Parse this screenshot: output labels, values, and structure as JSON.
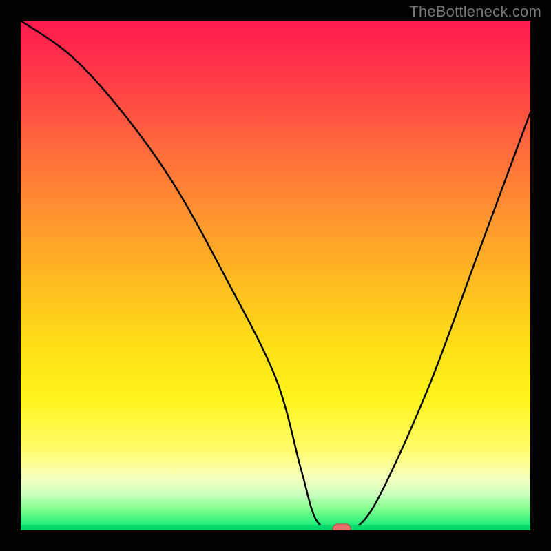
{
  "watermark": "TheBottleneck.com",
  "chart_data": {
    "type": "line",
    "title": "",
    "xlabel": "",
    "ylabel": "",
    "xlim": [
      0,
      100
    ],
    "ylim": [
      0,
      100
    ],
    "x": [
      0,
      10,
      20,
      30,
      40,
      50,
      55,
      58,
      62,
      65,
      70,
      80,
      90,
      100
    ],
    "values": [
      100,
      93,
      82,
      68,
      50,
      30,
      12,
      2,
      0,
      0,
      6,
      28,
      55,
      82
    ],
    "series": [
      {
        "name": "bottleneck-curve",
        "values": [
          100,
          93,
          82,
          68,
          50,
          30,
          12,
          2,
          0,
          0,
          6,
          28,
          55,
          82
        ]
      }
    ],
    "marker": {
      "x": 63,
      "y": 0,
      "color": "#e9746e",
      "shape": "pill"
    }
  }
}
